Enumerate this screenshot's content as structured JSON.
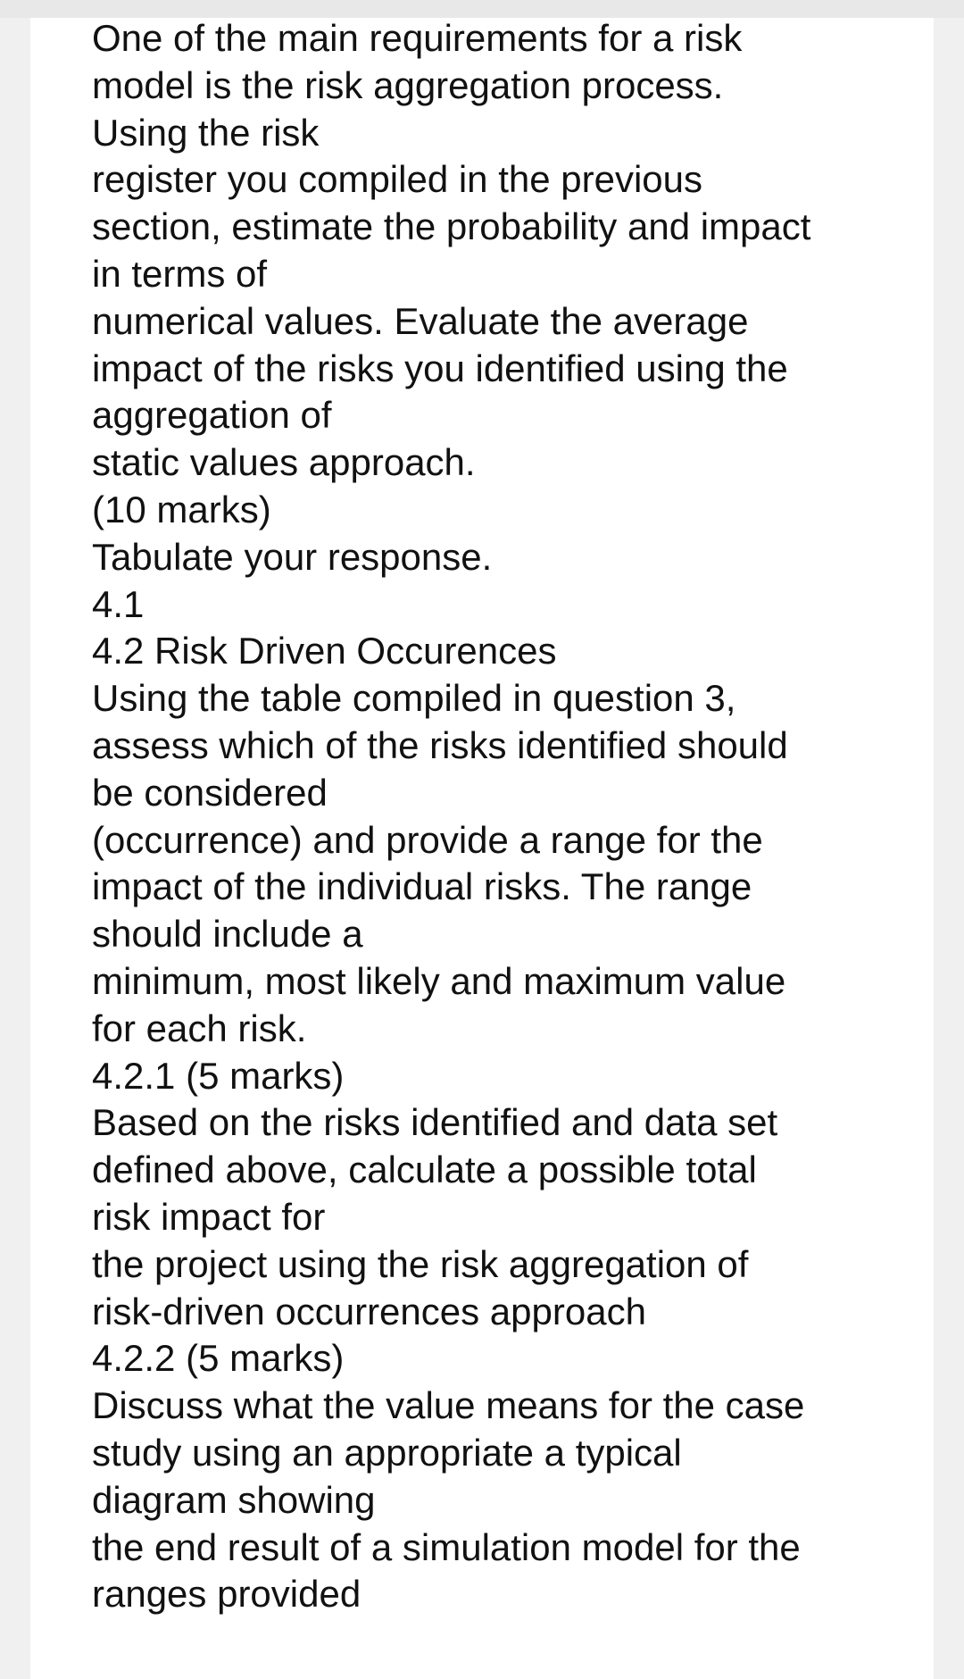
{
  "document": {
    "lines": [
      "One of the main requirements for a risk",
      "model is the risk aggregation process.",
      "Using the risk",
      "register you compiled in the previous",
      "section, estimate the probability and impact",
      "in terms of",
      "numerical values. Evaluate the average",
      "impact of the risks you identified using the",
      "aggregation of",
      "static values approach.",
      "(10 marks)",
      "Tabulate your response.",
      "4.1",
      "4.2 Risk Driven Occurences",
      "Using the table compiled in question 3,",
      "assess which of the risks identified should",
      "be considered",
      "(occurrence) and provide a range for the",
      "impact of the individual risks. The range",
      "should include a",
      "minimum, most likely and maximum value",
      "for each risk.",
      "4.2.1 (5 marks)",
      "Based on the risks identified and data set",
      "defined above, calculate a possible total",
      "risk impact for",
      "the project using the risk aggregation of",
      "risk-driven occurrences approach",
      "4.2.2 (5 marks)",
      "Discuss what the value means for the case",
      "study using an appropriate a typical",
      "diagram showing",
      "the end result of a simulation model for the",
      "ranges provided"
    ]
  },
  "colors": {
    "background": "#f0f0f0",
    "top_bar": "#e8e8e8",
    "card": "#ffffff",
    "text": "#111111"
  }
}
